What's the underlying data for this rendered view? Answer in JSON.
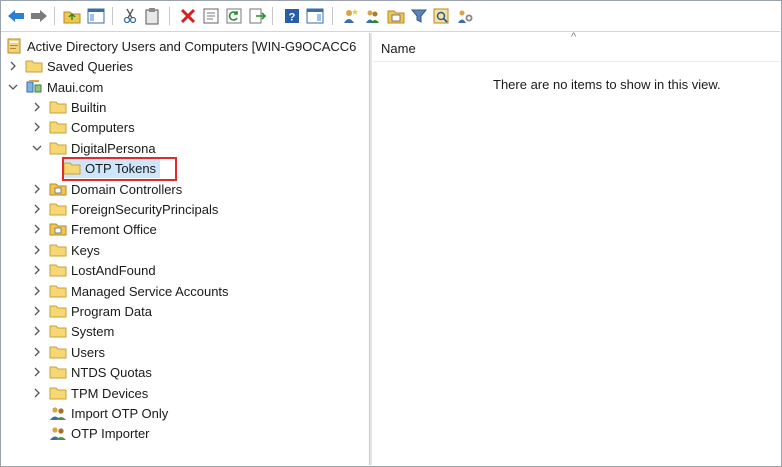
{
  "toolbar": {
    "buttons": [
      {
        "name": "back-button",
        "icon": "back-arrow-icon",
        "color": "#2c7fd6"
      },
      {
        "name": "forward-button",
        "icon": "forward-arrow-icon",
        "color": "#6b6b6b"
      },
      {
        "name": "up-one-level-button",
        "icon": "folder-up-icon"
      },
      {
        "name": "show-hide-console-tree-button",
        "icon": "console-tree-icon"
      },
      {
        "name": "cut-button",
        "icon": "scissors-icon"
      },
      {
        "name": "copy-button",
        "icon": "clipboard-icon"
      },
      {
        "name": "delete-button",
        "icon": "delete-x-icon",
        "color": "#d62020"
      },
      {
        "name": "properties-button",
        "icon": "properties-icon"
      },
      {
        "name": "refresh-button",
        "icon": "refresh-icon"
      },
      {
        "name": "export-list-button",
        "icon": "export-icon"
      },
      {
        "name": "help-button",
        "icon": "help-icon"
      },
      {
        "name": "show-hide-action-pane-button",
        "icon": "action-pane-icon"
      },
      {
        "name": "create-user-button",
        "icon": "new-user-icon"
      },
      {
        "name": "create-group-button",
        "icon": "new-group-icon"
      },
      {
        "name": "create-ou-button",
        "icon": "new-ou-icon"
      },
      {
        "name": "filter-button",
        "icon": "filter-icon"
      },
      {
        "name": "find-button",
        "icon": "find-icon"
      },
      {
        "name": "add-to-group-button",
        "icon": "add-to-group-icon"
      }
    ]
  },
  "tree": {
    "root": "Active Directory Users and Computers [WIN-G9OCACC6",
    "saved_queries": "Saved Queries",
    "domain": "Maui.com",
    "items": [
      {
        "label": "Builtin",
        "icon": "folder-icon"
      },
      {
        "label": "Computers",
        "icon": "folder-icon"
      },
      {
        "label": "DigitalPersona",
        "icon": "folder-icon",
        "expanded": true
      },
      {
        "label": "OTP Tokens",
        "icon": "folder-icon",
        "selected": true
      },
      {
        "label": "Domain Controllers",
        "icon": "ou-icon"
      },
      {
        "label": "ForeignSecurityPrincipals",
        "icon": "folder-icon"
      },
      {
        "label": "Fremont Office",
        "icon": "ou-icon"
      },
      {
        "label": "Keys",
        "icon": "folder-icon"
      },
      {
        "label": "LostAndFound",
        "icon": "folder-icon"
      },
      {
        "label": "Managed Service Accounts",
        "icon": "folder-icon"
      },
      {
        "label": "Program Data",
        "icon": "folder-icon"
      },
      {
        "label": "System",
        "icon": "folder-icon"
      },
      {
        "label": "Users",
        "icon": "folder-icon"
      },
      {
        "label": "NTDS Quotas",
        "icon": "folder-icon"
      },
      {
        "label": "TPM Devices",
        "icon": "folder-icon"
      },
      {
        "label": "Import OTP Only",
        "icon": "users-icon"
      },
      {
        "label": "OTP Importer",
        "icon": "users-icon"
      }
    ],
    "highlight_color": "#e02b2b"
  },
  "details": {
    "column_name": "Name",
    "sort_indicator": "^",
    "empty_message": "There are no items to show in this view."
  }
}
